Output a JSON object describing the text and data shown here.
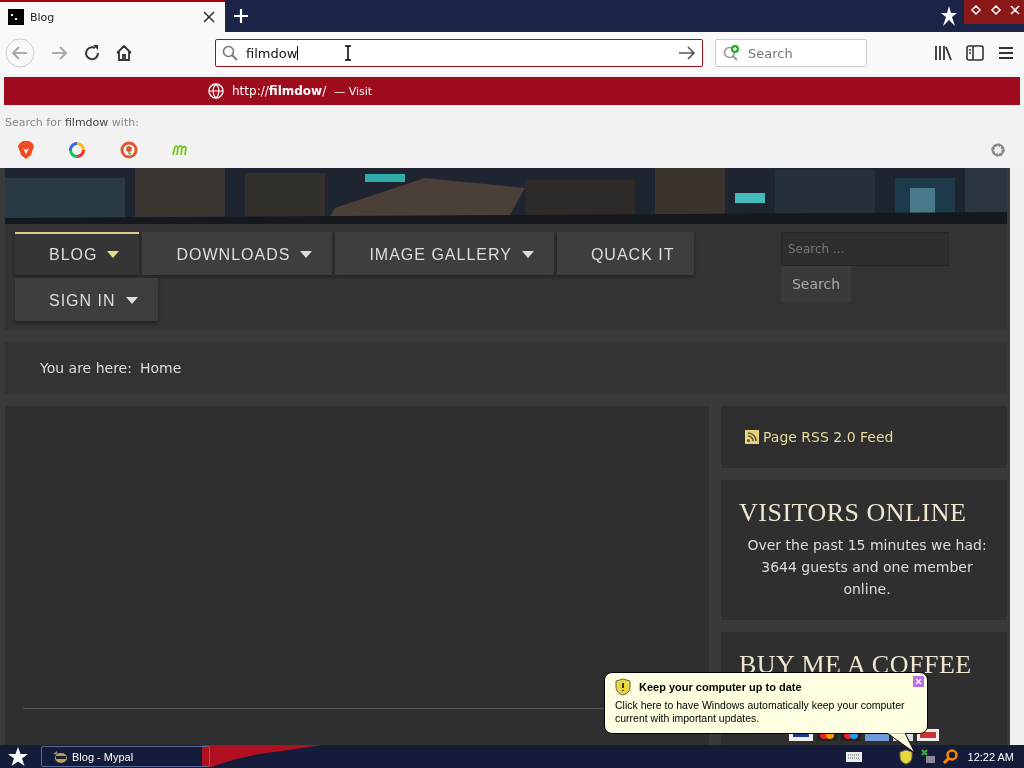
{
  "browser": {
    "tabs": [
      {
        "title": "Blog",
        "selected": true
      }
    ],
    "url": "filmdow",
    "search_placeholder": "Search",
    "suggestion": {
      "url": "http://**filmdow**/",
      "action": "— Visit"
    },
    "search_with": "Search for **filmdow** with:"
  },
  "site": {
    "nav": [
      {
        "label": "BLOG",
        "dropdown": true,
        "selected": true
      },
      {
        "label": "DOWNLOADS",
        "dropdown": true,
        "selected": false
      },
      {
        "label": "IMAGE GALLERY",
        "dropdown": true,
        "selected": false
      },
      {
        "label": "QUACK IT",
        "dropdown": false,
        "selected": false
      },
      {
        "label": "SIGN IN",
        "dropdown": true,
        "selected": false
      }
    ],
    "search": {
      "placeholder": "Search ...",
      "button": "Search"
    },
    "breadcrumb": {
      "label": "You are here:",
      "current": "Home"
    },
    "sidebar": {
      "rss": "Page RSS 2.0 Feed",
      "visitors_title": "VISITORS ONLINE",
      "visitors_text": "Over the past 15 minutes we had: 3644 guests and one member online.",
      "coffee_title": "BUY ME A COFFEE"
    }
  },
  "balloon": {
    "title": "Keep your computer up to date",
    "text": "Click here to have Windows automatically keep your computer current with important updates."
  },
  "taskbar": {
    "tasks": [
      {
        "label": "Blog - Mypal",
        "selected": false
      }
    ],
    "clock": "12:22 AM"
  }
}
